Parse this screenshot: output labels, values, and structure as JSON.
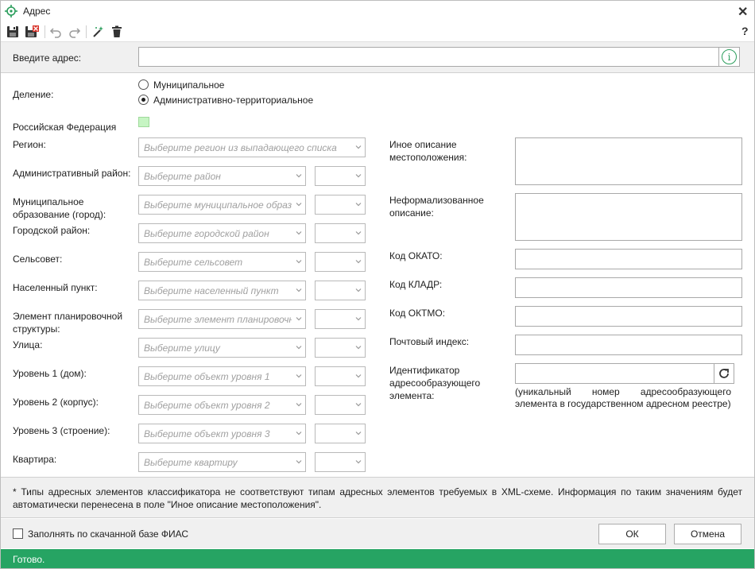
{
  "window": {
    "title": "Адрес",
    "close_icon": "close-icon",
    "help": "?"
  },
  "toolbar": {
    "icons": [
      "save-icon",
      "save-close-icon",
      "undo-icon",
      "redo-icon",
      "wand-icon",
      "delete-icon"
    ]
  },
  "address_input": {
    "label": "Введите адрес:",
    "value": "",
    "info_icon": "i"
  },
  "division": {
    "label": "Деление:",
    "options": [
      "Муниципальное",
      "Административно-территориальное"
    ],
    "selected": 1
  },
  "country_label": "Российская Федерация",
  "left_fields": [
    {
      "label": "Регион:",
      "placeholder": "Выберите регион из выпадающего списка"
    },
    {
      "label": "Административный район:",
      "placeholder": "Выберите район"
    },
    {
      "label": "Муниципальное образование (город):",
      "placeholder": "Выберите муниципальное образование"
    },
    {
      "label": "Городской район:",
      "placeholder": "Выберите городской район"
    },
    {
      "label": "Сельсовет:",
      "placeholder": "Выберите сельсовет"
    },
    {
      "label": "Населенный пункт:",
      "placeholder": "Выберите населенный пункт"
    },
    {
      "label": "Элемент планировочной структуры:",
      "placeholder": "Выберите элемент планировочной структуры"
    },
    {
      "label": "Улица:",
      "placeholder": "Выберите улицу"
    },
    {
      "label": "Уровень 1 (дом):",
      "placeholder": "Выберите объект уровня 1"
    },
    {
      "label": "Уровень 2 (корпус):",
      "placeholder": "Выберите объект уровня 2"
    },
    {
      "label": "Уровень 3 (строение):",
      "placeholder": "Выберите объект уровня 3"
    },
    {
      "label": "Квартира:",
      "placeholder": "Выберите квартиру"
    }
  ],
  "right_fields": {
    "other_description": {
      "label": "Иное описание местоположения:",
      "value": ""
    },
    "informal_description": {
      "label": "Неформализованное описание:",
      "value": ""
    },
    "okato": {
      "label": "Код ОКАТО:",
      "value": ""
    },
    "kladr": {
      "label": "Код КЛАДР:",
      "value": ""
    },
    "oktmo": {
      "label": "Код ОКТМО:",
      "value": ""
    },
    "postal_index": {
      "label": "Почтовый индекс:",
      "value": ""
    },
    "identifier": {
      "label": "Идентификатор адресообразующего элемента:",
      "value": "",
      "hint_line1": "(уникальный номер адресообразующего",
      "hint_line2": "элемента в государственном адресном реестре)"
    }
  },
  "note": "* Типы адресных элементов классификатора не соответствуют типам адресных элементов требуемых в XML-схеме. Информация по таким значениям будет автоматически перенесена в поле \"Иное описание местоположения\".",
  "fias_checkbox": {
    "label": "Заполнять по скачанной базе ФИАС",
    "checked": false
  },
  "buttons": {
    "ok": "ОК",
    "cancel": "Отмена"
  },
  "status": {
    "text": "Готово.",
    "color": "#26a463"
  },
  "colors": {
    "accent_green": "#26a463",
    "info_green": "#2a9d5b"
  }
}
